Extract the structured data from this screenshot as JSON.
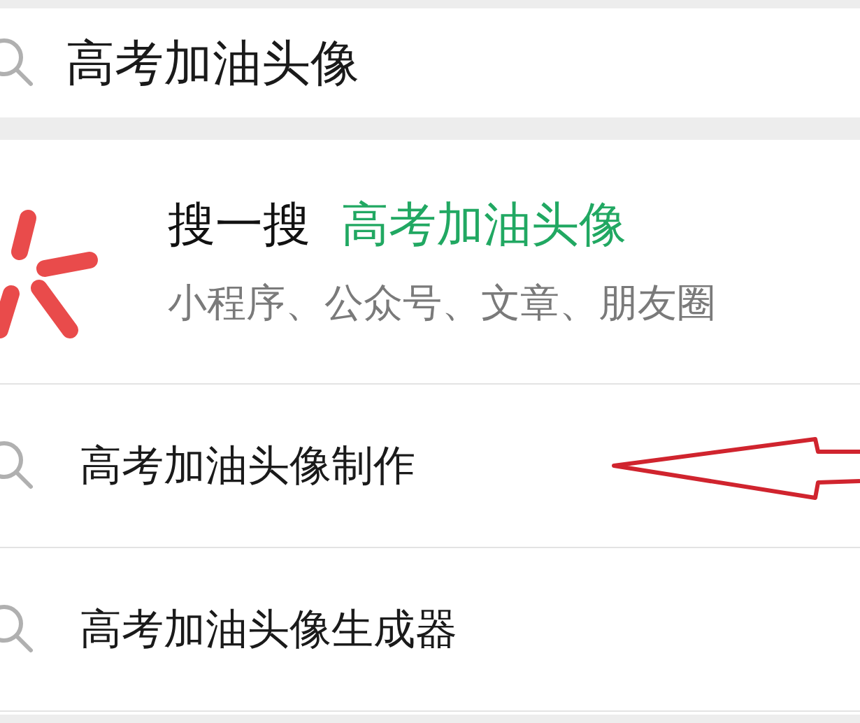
{
  "search_bar": {
    "value": "高考加油头像"
  },
  "search_one": {
    "label": "搜一搜",
    "query": "高考加油头像",
    "subtitle": "小程序、公众号、文章、朋友圈"
  },
  "suggestions": [
    {
      "text": "高考加油头像制作",
      "annotated": true
    },
    {
      "text": "高考加油头像生成器",
      "annotated": false
    }
  ]
}
